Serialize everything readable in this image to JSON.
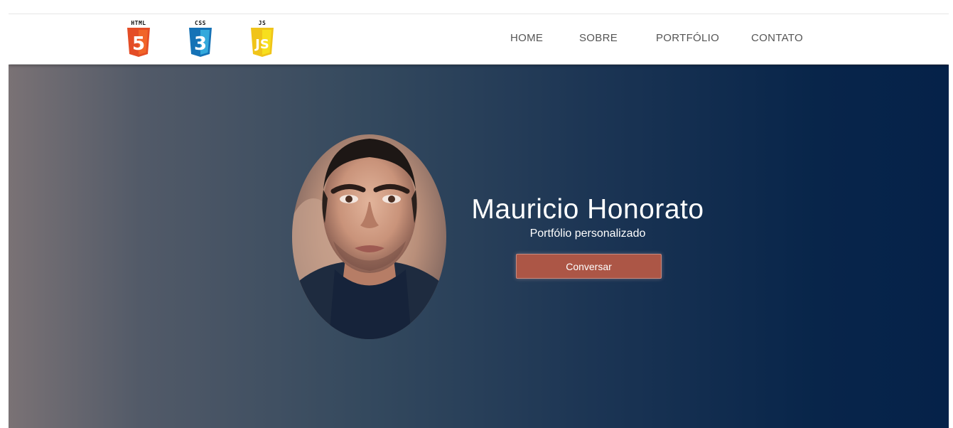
{
  "logos": [
    {
      "label": "HTML",
      "glyph": "5",
      "icon": "html5-icon",
      "color": "#e44d26",
      "shade": "#f16529"
    },
    {
      "label": "CSS",
      "glyph": "3",
      "icon": "css3-icon",
      "color": "#1572b6",
      "shade": "#33a9dc"
    },
    {
      "label": "JS",
      "glyph": "JS",
      "icon": "javascript-icon",
      "color": "#f0c419",
      "shade": "#f7df1e"
    }
  ],
  "nav": {
    "items": [
      {
        "label": "HOME"
      },
      {
        "label": "SOBRE"
      },
      {
        "label": "PORTFÓLIO"
      },
      {
        "label": "CONTATO"
      }
    ]
  },
  "hero": {
    "name": "Mauricio Honorato",
    "subtitle": "Portfólio personalizado",
    "button_label": "Conversar",
    "button_color": "#ac5646",
    "gradient_start": "#7a7275",
    "gradient_end": "#052249"
  }
}
